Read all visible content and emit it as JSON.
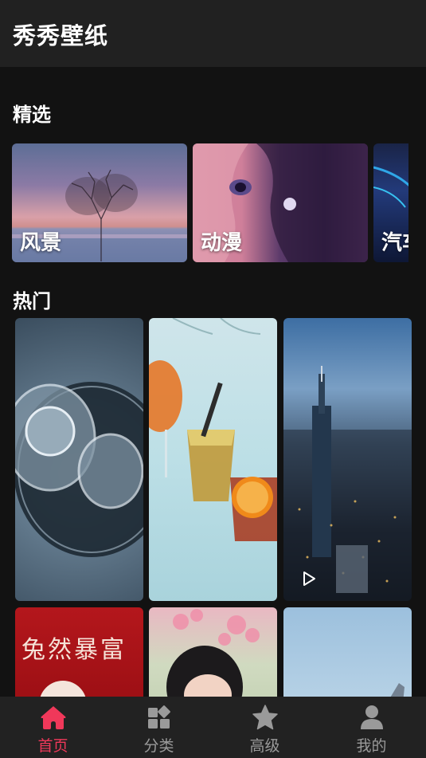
{
  "app": {
    "title": "秀秀壁纸"
  },
  "featured": {
    "title": "精选",
    "items": [
      {
        "label": "风景"
      },
      {
        "label": "动漫"
      },
      {
        "label": "汽车"
      }
    ]
  },
  "popular": {
    "title": "热门",
    "items": [
      {
        "type": "image"
      },
      {
        "type": "image"
      },
      {
        "type": "video",
        "icon": "play-icon"
      },
      {
        "type": "image",
        "text": "兔然暴富"
      },
      {
        "type": "image"
      },
      {
        "type": "image"
      }
    ]
  },
  "tabbar": {
    "tabs": [
      {
        "label": "首页",
        "icon": "home-icon",
        "active": true
      },
      {
        "label": "分类",
        "icon": "category-icon",
        "active": false
      },
      {
        "label": "高级",
        "icon": "star-icon",
        "active": false
      },
      {
        "label": "我的",
        "icon": "profile-icon",
        "active": false
      }
    ]
  },
  "colors": {
    "accent": "#f0385a",
    "background": "#121212",
    "appbar": "#212121",
    "tabbar": "#222222"
  }
}
